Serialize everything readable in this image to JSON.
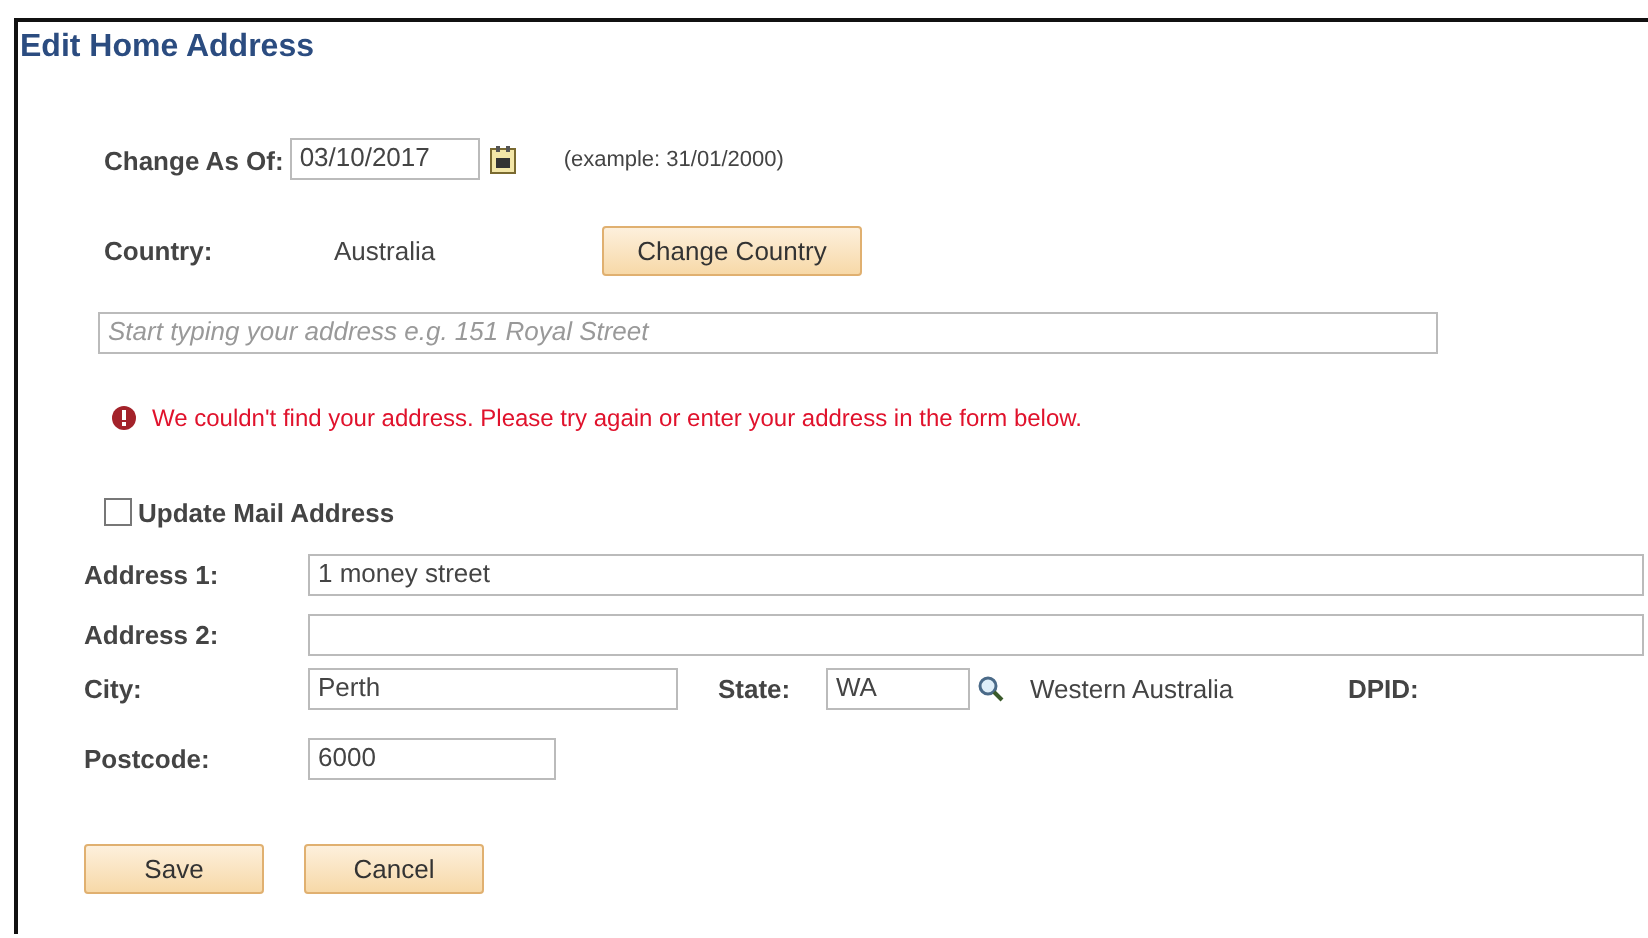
{
  "title": "Edit Home Address",
  "change_as_of": {
    "label": "Change As Of:",
    "value": "03/10/2017",
    "hint": "(example: 31/01/2000)"
  },
  "country": {
    "label": "Country:",
    "value": "Australia",
    "button": "Change Country"
  },
  "address_search": {
    "placeholder": "Start typing your address e.g. 151 Royal Street"
  },
  "error_message": "We couldn't find your address. Please try again or enter your address in the form below.",
  "update_mail": {
    "label": "Update Mail Address",
    "checked": false
  },
  "address_1": {
    "label": "Address 1:",
    "value": "1 money street"
  },
  "address_2": {
    "label": "Address 2:"
  },
  "city": {
    "label": "City:",
    "value": "Perth"
  },
  "state": {
    "label": "State:",
    "value": "WA",
    "description": "Western Australia"
  },
  "dpid": {
    "label": "DPID:"
  },
  "postcode": {
    "label": "Postcode:",
    "value": "6000"
  },
  "buttons": [
    "Save",
    "Cancel"
  ]
}
